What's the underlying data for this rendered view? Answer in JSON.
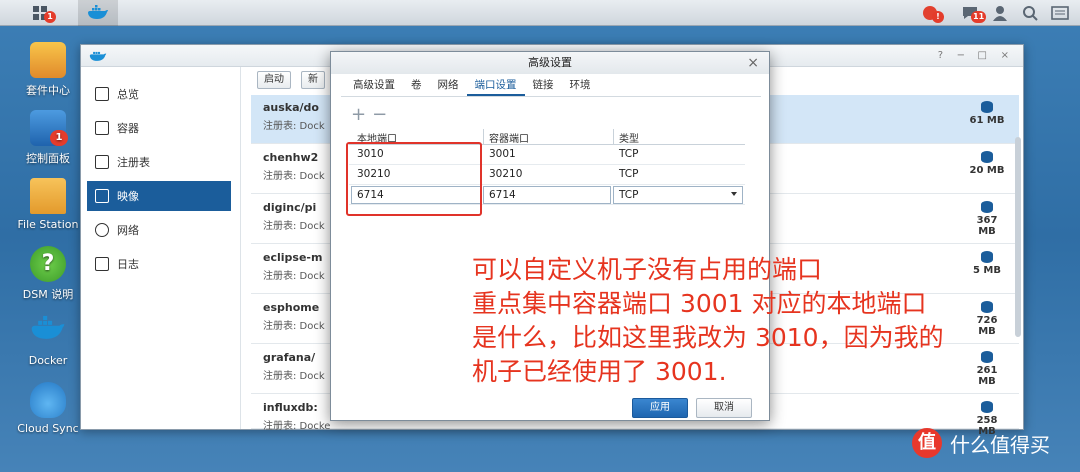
{
  "taskbar": {
    "main_menu_badge": "1",
    "notifications_badge": "!",
    "chat_badge": "11"
  },
  "desktop": {
    "icons": [
      {
        "label": "套件中心",
        "badge": ""
      },
      {
        "label": "控制面板",
        "badge": "1"
      },
      {
        "label": "File Station",
        "badge": ""
      },
      {
        "label": "DSM 说明",
        "badge": ""
      },
      {
        "label": "Docker",
        "badge": ""
      },
      {
        "label": "Cloud Sync",
        "badge": ""
      }
    ]
  },
  "window": {
    "controls": [
      "?",
      "−",
      "□",
      "×"
    ],
    "sidebar": [
      {
        "label": "总览",
        "icon": "overview-icon"
      },
      {
        "label": "容器",
        "icon": "container-icon"
      },
      {
        "label": "注册表",
        "icon": "registry-icon"
      },
      {
        "label": "映像",
        "icon": "image-icon"
      },
      {
        "label": "网络",
        "icon": "network-icon"
      },
      {
        "label": "日志",
        "icon": "log-icon"
      }
    ],
    "active_sidebar": "映像",
    "toolbar": {
      "launch": "启动",
      "new_partial": "新"
    },
    "images": [
      {
        "name": "auska/do",
        "registry": "注册表: Dock",
        "size": "61 MB"
      },
      {
        "name": "chenhw2",
        "registry": "注册表: Dock",
        "size": "20 MB"
      },
      {
        "name": "diginc/pi",
        "registry": "注册表: Dock",
        "size": "367 MB"
      },
      {
        "name": "eclipse-m",
        "registry": "注册表: Dock",
        "size": "5 MB"
      },
      {
        "name": "esphome",
        "registry": "注册表: Dock",
        "size": "726 MB"
      },
      {
        "name": "grafana/",
        "registry": "注册表: Dock",
        "size": "261 MB"
      },
      {
        "name": "influxdb:",
        "registry": "注册表: Docke",
        "size": "258 MB"
      }
    ],
    "behind_dialog_label": "容"
  },
  "dialog": {
    "title": "高级设置",
    "close": "×",
    "tabs": [
      "高级设置",
      "卷",
      "网络",
      "端口设置",
      "链接",
      "环境"
    ],
    "active_tab": "端口设置",
    "add_label": "+",
    "remove_label": "−",
    "columns": [
      "本地端口",
      "容器端口",
      "类型"
    ],
    "rows": [
      {
        "local": "3010",
        "container": "3001",
        "type": "TCP"
      },
      {
        "local": "30210",
        "container": "30210",
        "type": "TCP"
      },
      {
        "local": "6714",
        "container": "6714",
        "type": "TCP"
      }
    ],
    "apply": "应用",
    "cancel": "取消"
  },
  "annotation": {
    "lines": [
      "可以自定义机子没有占用的端口",
      "重点集中容器端口 3001 对应的本地端口",
      "是什么，比如这里我改为 3010，因为我的",
      "机子已经使用了 3001."
    ]
  },
  "watermark": {
    "badge": "值",
    "text": "什么值得买"
  },
  "colors": {
    "accent": "#1b5d9b",
    "annotation_red": "#e6341f",
    "desktop_bg": "#3d7fb6"
  }
}
